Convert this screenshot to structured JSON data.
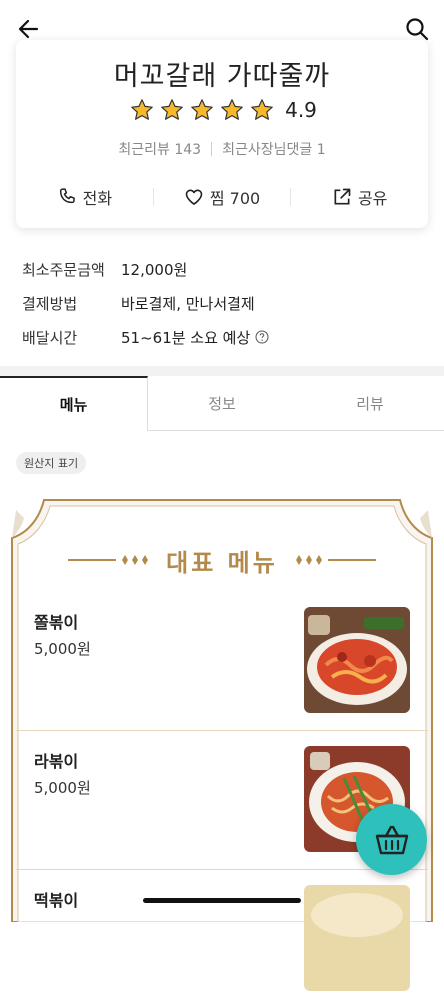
{
  "store": {
    "name": "머꼬갈래 가따줄까",
    "rating": "4.9",
    "stars": 5,
    "recent_reviews": "최근리뷰 143",
    "owner_replies": "최근사장님댓글 1"
  },
  "actions": {
    "call": "전화",
    "favorite": "찜 700",
    "share": "공유"
  },
  "info": [
    {
      "label": "최소주문금액",
      "value": "12,000원"
    },
    {
      "label": "결제방법",
      "value": "바로결제, 만나서결제"
    },
    {
      "label": "배달시간",
      "value": "51~61분 소요 예상"
    }
  ],
  "tabs": [
    "메뉴",
    "정보",
    "리뷰"
  ],
  "origin_chip": "원산지 표기",
  "featured_title": "대표 메뉴",
  "menu": [
    {
      "name": "쫄볶이",
      "price": "5,000원"
    },
    {
      "name": "라볶이",
      "price": "5,000원"
    },
    {
      "name": "떡볶이",
      "price": ""
    }
  ],
  "icons": {
    "back": "back-arrow-icon",
    "search": "search-icon",
    "call": "phone-icon",
    "favorite": "heart-icon",
    "share": "share-icon",
    "help": "question-circle-icon",
    "cart": "basket-icon"
  },
  "colors": {
    "accent": "#2ec1bc",
    "star": "#f6b92b",
    "gold": "#b38a4b"
  }
}
